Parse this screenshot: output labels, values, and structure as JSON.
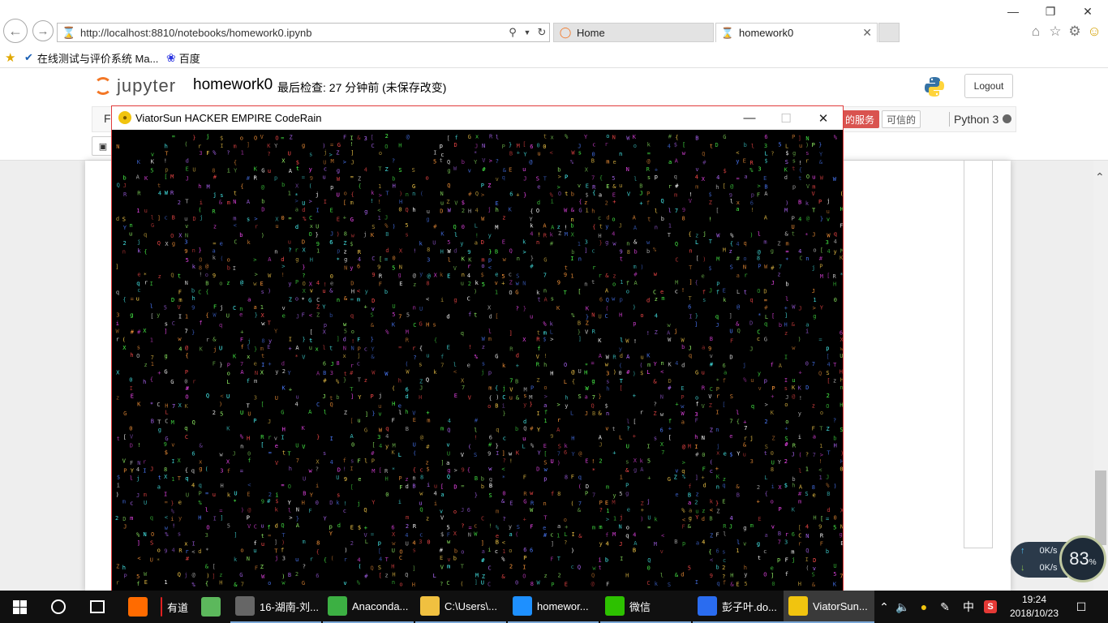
{
  "browser": {
    "url": "http://localhost:8810/notebooks/homework0.ipynb",
    "tabs": [
      {
        "label": "Home"
      },
      {
        "label": "homework0"
      }
    ],
    "favorites": [
      {
        "label": "在线测试与评价系统 Ma..."
      },
      {
        "label": "百度"
      }
    ],
    "window_controls": {
      "minimize": "—",
      "restore": "❐",
      "close": "✕"
    }
  },
  "jupyter": {
    "logo_text": "jupyter",
    "notebook_name": "homework0",
    "checkpoint": "最后检查: 27 分钟前  (未保存改变)",
    "logout_label": "Logout",
    "menu_first_letter": "F",
    "trusted_service": "的服务",
    "trusted_label": "可信的",
    "kernel_name": "Python 3"
  },
  "coderain_window": {
    "title": "ViatorSun HACKER EMPIRE CodeRain",
    "minimize": "—",
    "maximize": "☐",
    "close": "✕",
    "charset": "ABCDEFGHIJKLMNOPQRSTUVWXYZabcdefghijklmnopqrstuvwxyz0123456789@#$%&*!?<>=+{}[]()",
    "colors": [
      "#ff4d4d",
      "#4dff4d",
      "#4d7dff",
      "#ffd24d",
      "#ff4dff",
      "#4dffff",
      "#ff9a3c",
      "#b46bff",
      "#ffffff",
      "#9aff6b"
    ]
  },
  "net_widget": {
    "up": "0K/s",
    "down": "0K/s",
    "percent": "83",
    "percent_sign": "%"
  },
  "taskbar": {
    "apps": [
      {
        "label": "",
        "icon": "youdao-dict-icon",
        "color": "#ff6b00"
      },
      {
        "label": "有道",
        "icon": "youdao-note-icon",
        "color": "#e02020"
      },
      {
        "label": "",
        "icon": "360-icon",
        "color": "#5cb85c"
      },
      {
        "label": "16-湖南-刘...",
        "icon": "qq-chat-icon",
        "color": "#666666"
      },
      {
        "label": "Anaconda...",
        "icon": "anaconda-icon",
        "color": "#3cb043"
      },
      {
        "label": "C:\\Users\\...",
        "icon": "folder-icon",
        "color": "#f0c040"
      },
      {
        "label": "homewor...",
        "icon": "ie-icon",
        "color": "#1e90ff"
      },
      {
        "label": "微信",
        "icon": "wechat-icon",
        "color": "#2dc100"
      },
      {
        "label": "彭子叶.do...",
        "icon": "wps-icon",
        "color": "#2a6cf0"
      },
      {
        "label": "ViatorSun...",
        "icon": "python-icon",
        "color": "#f1c40f"
      }
    ],
    "tray": {
      "ime": "中",
      "time": "19:24",
      "date": "2018/10/23"
    }
  }
}
